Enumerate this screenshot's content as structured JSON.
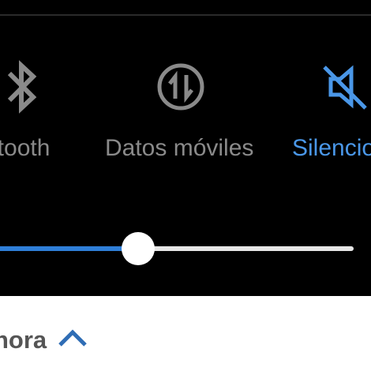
{
  "quick_settings": {
    "tiles": [
      {
        "label": "etooth",
        "icon": "bluetooth-icon",
        "state": "off"
      },
      {
        "label": "Datos móviles",
        "icon": "mobile-data-icon",
        "state": "off"
      },
      {
        "label": "Silencio",
        "icon": "mute-icon",
        "state": "on"
      }
    ],
    "brightness_slider": {
      "level": 0.39
    }
  },
  "footer": {
    "label": "nora",
    "icon": "chevron-up-icon"
  },
  "colors": {
    "panel_bg": "#000000",
    "inactive": "#8a8a8a",
    "active": "#4a97e8",
    "slider_fill": "#2f7fd8",
    "footer_text": "#555555",
    "footer_accent": "#2f6db5"
  }
}
